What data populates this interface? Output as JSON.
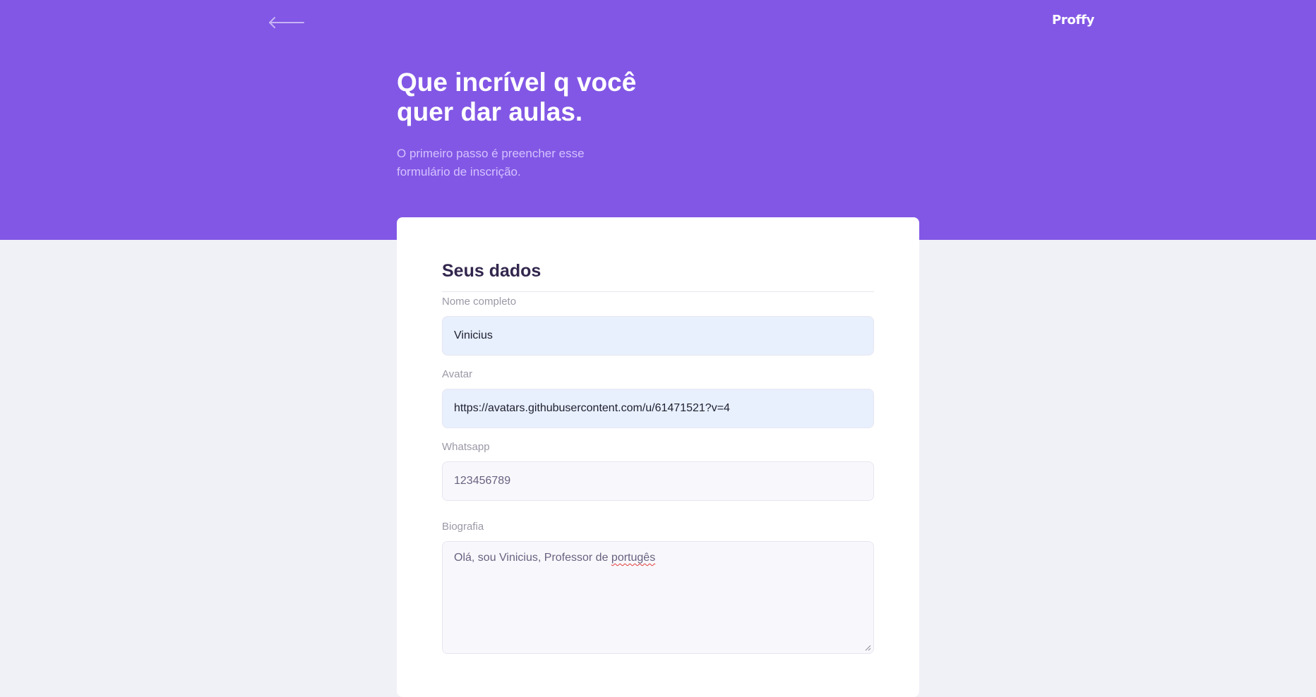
{
  "header": {
    "back_icon": "arrow-left-icon",
    "brand": "Proffy",
    "title_line1": "Que incrível q você",
    "title_line2": "quer dar aulas.",
    "description_line1": "O primeiro passo é preencher esse",
    "description_line2": "formulário de inscrição."
  },
  "form": {
    "legend": "Seus dados",
    "fields": {
      "name": {
        "label": "Nome completo",
        "value": "Vinicius"
      },
      "avatar": {
        "label": "Avatar",
        "value": "https://avatars.githubusercontent.com/u/61471521?v=4"
      },
      "whatsapp": {
        "label": "Whatsapp",
        "value": "123456789"
      },
      "bio": {
        "label": "Biografia",
        "value_prefix": "Olá, sou Vinicius, Professor de ",
        "value_misspelled": "portugês"
      }
    }
  },
  "colors": {
    "primary": "#8257e5",
    "background": "#f0f0f7",
    "card": "#ffffff",
    "title_dark": "#32264d",
    "autofill": "#e8f0fe"
  }
}
